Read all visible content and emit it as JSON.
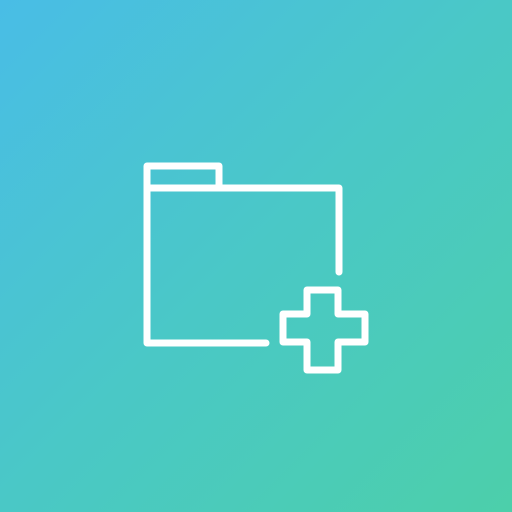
{
  "icon": {
    "name": "folder-add-icon",
    "stroke_color": "#ffffff"
  },
  "background": {
    "gradient_start": "#49bde6",
    "gradient_end": "#4ccfaa"
  }
}
